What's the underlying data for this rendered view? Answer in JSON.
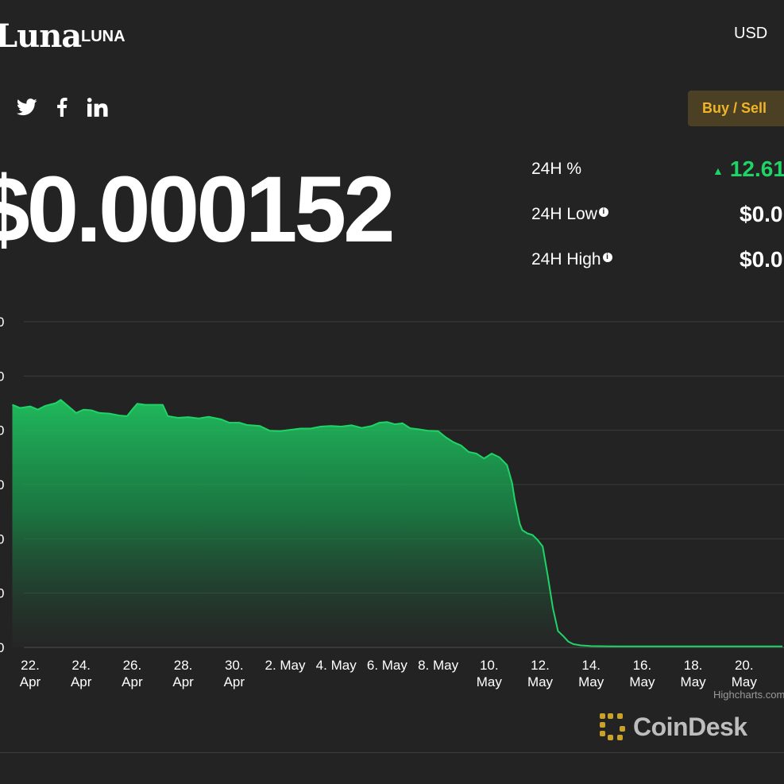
{
  "header": {
    "brand_name": "Luna",
    "ticker": "LUNA",
    "currency": "USD",
    "buy_sell_label": "Buy / Sell"
  },
  "social": [
    "twitter-icon",
    "facebook-icon",
    "linkedin-icon"
  ],
  "price": "$0.000152",
  "stats": {
    "change_label": "24H %",
    "change_value": "12.61",
    "low_label": "24H Low",
    "low_value": "$0.0",
    "high_label": "24H High",
    "high_value": "$0.0"
  },
  "colors": {
    "background": "#232323",
    "line": "#1fd466",
    "positive": "#1fd466",
    "accent": "#f0b429"
  },
  "chart_data": {
    "type": "area",
    "title": "",
    "xlabel": "",
    "ylabel": "",
    "grid": true,
    "x_tick_labels": [
      "22. Apr",
      "24. Apr",
      "26. Apr",
      "28. Apr",
      "30. Apr",
      "2. May",
      "4. May",
      "6. May",
      "8. May",
      "10. May",
      "12. May",
      "14. May",
      "16. May",
      "18. May",
      "20. May"
    ],
    "x_ticks_day": [
      1,
      3,
      5,
      7,
      9,
      11,
      13,
      15,
      17,
      19,
      21,
      23,
      25,
      27,
      29
    ],
    "x_range_day": [
      0.3,
      30.5
    ],
    "y_gridlines": 7,
    "y_tick_labels_visible": false,
    "series": [
      {
        "points": [
          [
            0.3,
            0.745
          ],
          [
            0.6,
            0.735
          ],
          [
            1.0,
            0.74
          ],
          [
            1.3,
            0.73
          ],
          [
            1.6,
            0.742
          ],
          [
            2.0,
            0.75
          ],
          [
            2.2,
            0.76
          ],
          [
            2.5,
            0.74
          ],
          [
            2.8,
            0.72
          ],
          [
            3.1,
            0.73
          ],
          [
            3.4,
            0.728
          ],
          [
            3.7,
            0.72
          ],
          [
            4.1,
            0.718
          ],
          [
            4.5,
            0.712
          ],
          [
            4.8,
            0.71
          ],
          [
            5.0,
            0.73
          ],
          [
            5.2,
            0.748
          ],
          [
            5.5,
            0.745
          ],
          [
            5.8,
            0.745
          ],
          [
            6.2,
            0.745
          ],
          [
            6.4,
            0.71
          ],
          [
            6.8,
            0.705
          ],
          [
            7.2,
            0.707
          ],
          [
            7.6,
            0.703
          ],
          [
            8.0,
            0.708
          ],
          [
            8.5,
            0.7
          ],
          [
            8.8,
            0.69
          ],
          [
            9.2,
            0.69
          ],
          [
            9.5,
            0.683
          ],
          [
            10.0,
            0.68
          ],
          [
            10.4,
            0.665
          ],
          [
            10.8,
            0.664
          ],
          [
            11.2,
            0.668
          ],
          [
            11.6,
            0.672
          ],
          [
            12.0,
            0.672
          ],
          [
            12.4,
            0.678
          ],
          [
            12.8,
            0.68
          ],
          [
            13.2,
            0.678
          ],
          [
            13.6,
            0.682
          ],
          [
            14.0,
            0.674
          ],
          [
            14.4,
            0.68
          ],
          [
            14.7,
            0.69
          ],
          [
            15.0,
            0.692
          ],
          [
            15.3,
            0.685
          ],
          [
            15.6,
            0.688
          ],
          [
            15.9,
            0.673
          ],
          [
            16.2,
            0.67
          ],
          [
            16.6,
            0.665
          ],
          [
            17.0,
            0.664
          ],
          [
            17.3,
            0.645
          ],
          [
            17.6,
            0.63
          ],
          [
            17.9,
            0.62
          ],
          [
            18.2,
            0.6
          ],
          [
            18.5,
            0.595
          ],
          [
            18.8,
            0.58
          ],
          [
            19.1,
            0.595
          ],
          [
            19.4,
            0.584
          ],
          [
            19.7,
            0.56
          ],
          [
            19.9,
            0.505
          ],
          [
            20.0,
            0.455
          ],
          [
            20.2,
            0.38
          ],
          [
            20.3,
            0.36
          ],
          [
            20.5,
            0.35
          ],
          [
            20.7,
            0.345
          ],
          [
            20.9,
            0.33
          ],
          [
            21.1,
            0.31
          ],
          [
            21.3,
            0.22
          ],
          [
            21.5,
            0.12
          ],
          [
            21.7,
            0.05
          ],
          [
            21.9,
            0.035
          ],
          [
            22.1,
            0.018
          ],
          [
            22.3,
            0.01
          ],
          [
            22.6,
            0.006
          ],
          [
            23.0,
            0.004
          ],
          [
            24.0,
            0.003
          ],
          [
            26.0,
            0.003
          ],
          [
            28.0,
            0.003
          ],
          [
            30.5,
            0.003
          ]
        ]
      }
    ]
  }
}
